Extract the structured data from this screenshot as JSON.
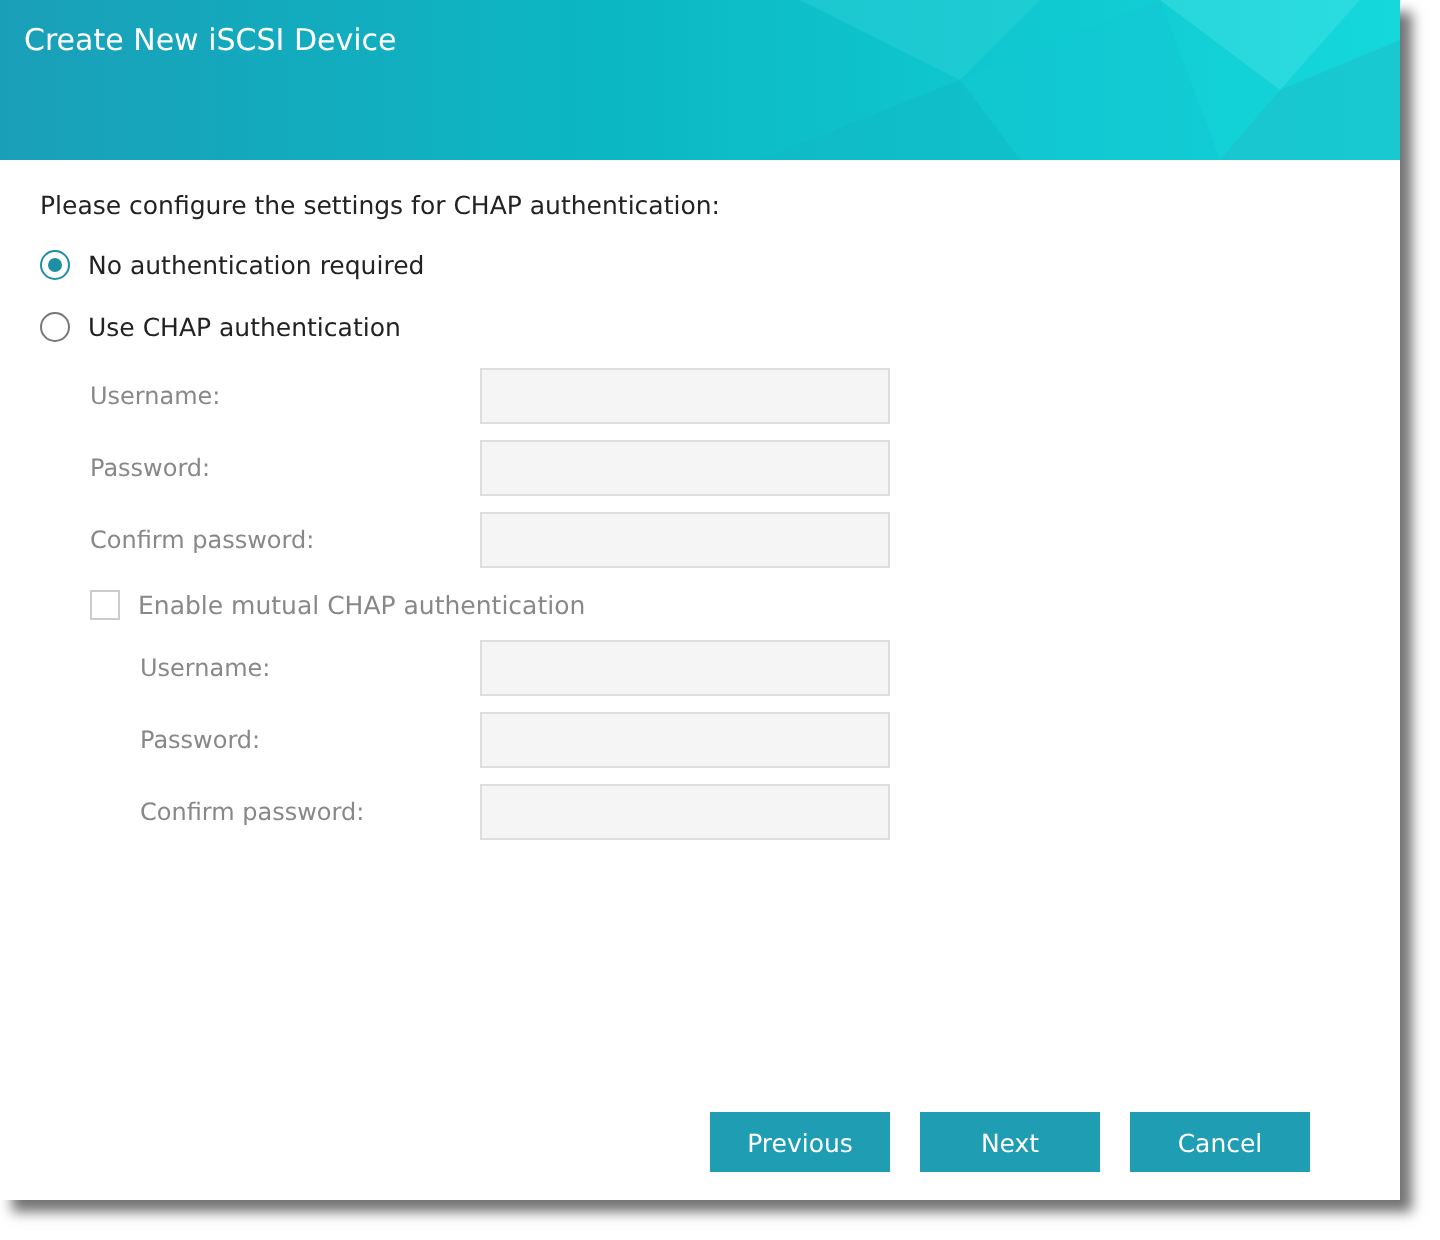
{
  "window": {
    "title": "Create New iSCSI Device"
  },
  "prompt": "Please configure the settings for CHAP authentication:",
  "auth_options": [
    {
      "label": "No authentication required",
      "selected": true
    },
    {
      "label": "Use CHAP authentication",
      "selected": false
    }
  ],
  "chap": {
    "disabled": true,
    "fields": [
      {
        "label": "Username:"
      },
      {
        "label": "Password:"
      },
      {
        "label": "Confirm password:"
      }
    ]
  },
  "mutual": {
    "label": "Enable mutual CHAP authentication",
    "checked": false,
    "disabled": true,
    "fields": [
      {
        "label": "Username:"
      },
      {
        "label": "Password:"
      },
      {
        "label": "Confirm password:"
      }
    ]
  },
  "buttons": [
    "Previous",
    "Next",
    "Cancel"
  ]
}
